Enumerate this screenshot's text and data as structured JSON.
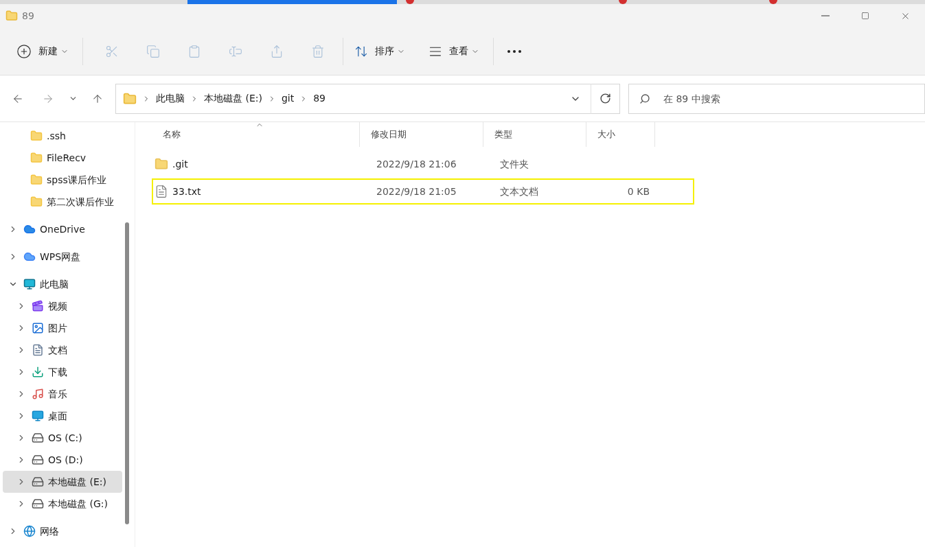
{
  "window": {
    "title": "89"
  },
  "toolbar": {
    "new_button": {
      "label": "新建"
    },
    "actions": [
      {
        "kind": "cut",
        "disabled": true
      },
      {
        "kind": "copy",
        "disabled": true
      },
      {
        "kind": "paste",
        "disabled": true
      },
      {
        "kind": "rename",
        "disabled": true
      },
      {
        "kind": "share",
        "disabled": true
      },
      {
        "kind": "delete",
        "disabled": true
      }
    ],
    "sort_button": {
      "label": "排序"
    },
    "view_button": {
      "label": "查看"
    }
  },
  "address_bar": {
    "path": [
      "此电脑",
      "本地磁盘 (E:)",
      "git",
      "89"
    ]
  },
  "search": {
    "placeholder": "在 89 中搜索"
  },
  "sidebar": {
    "scrolled_children": [
      {
        "label": ".ssh",
        "kind": "folder"
      },
      {
        "label": "FileRecv",
        "kind": "folder"
      },
      {
        "label": "spss课后作业",
        "kind": "folder"
      },
      {
        "label": "第二次课后作业",
        "kind": "folder"
      }
    ],
    "items": [
      {
        "label": "OneDrive",
        "kind": "cloud",
        "expanded": false,
        "selected": false
      },
      {
        "label": "WPS网盘",
        "kind": "cloud2",
        "expanded": false,
        "selected": false
      },
      {
        "label": "此电脑",
        "kind": "pc",
        "expanded": true,
        "selected": false,
        "children": [
          {
            "label": "视频",
            "kind": "video",
            "expanded": false,
            "selected": false
          },
          {
            "label": "图片",
            "kind": "picture",
            "expanded": false,
            "selected": false
          },
          {
            "label": "文档",
            "kind": "document",
            "expanded": false,
            "selected": false
          },
          {
            "label": "下载",
            "kind": "download",
            "expanded": false,
            "selected": false
          },
          {
            "label": "音乐",
            "kind": "music",
            "expanded": false,
            "selected": false
          },
          {
            "label": "桌面",
            "kind": "desktop",
            "expanded": false,
            "selected": false
          },
          {
            "label": "OS (C:)",
            "kind": "osdrive",
            "expanded": false,
            "selected": false
          },
          {
            "label": "OS (D:)",
            "kind": "drive",
            "expanded": false,
            "selected": false
          },
          {
            "label": "本地磁盘 (E:)",
            "kind": "drive",
            "expanded": false,
            "selected": true
          },
          {
            "label": "本地磁盘 (G:)",
            "kind": "drive",
            "expanded": false,
            "selected": false
          }
        ]
      },
      {
        "label": "网络",
        "kind": "network",
        "expanded": false,
        "selected": false
      }
    ]
  },
  "table": {
    "columns": [
      {
        "label": "名称",
        "sorted": true
      },
      {
        "label": "修改日期",
        "sorted": false
      },
      {
        "label": "类型",
        "sorted": false
      },
      {
        "label": "大小",
        "sorted": false
      }
    ],
    "rows": [
      {
        "kind": "folder",
        "name": ".git",
        "modified": "2022/9/18 21:06",
        "type": "文件夹",
        "highlighted": false
      },
      {
        "kind": "text",
        "name": "33.txt",
        "modified": "2022/9/18 21:05",
        "type": "文本文档",
        "size": "0 KB",
        "highlighted": true
      }
    ]
  }
}
